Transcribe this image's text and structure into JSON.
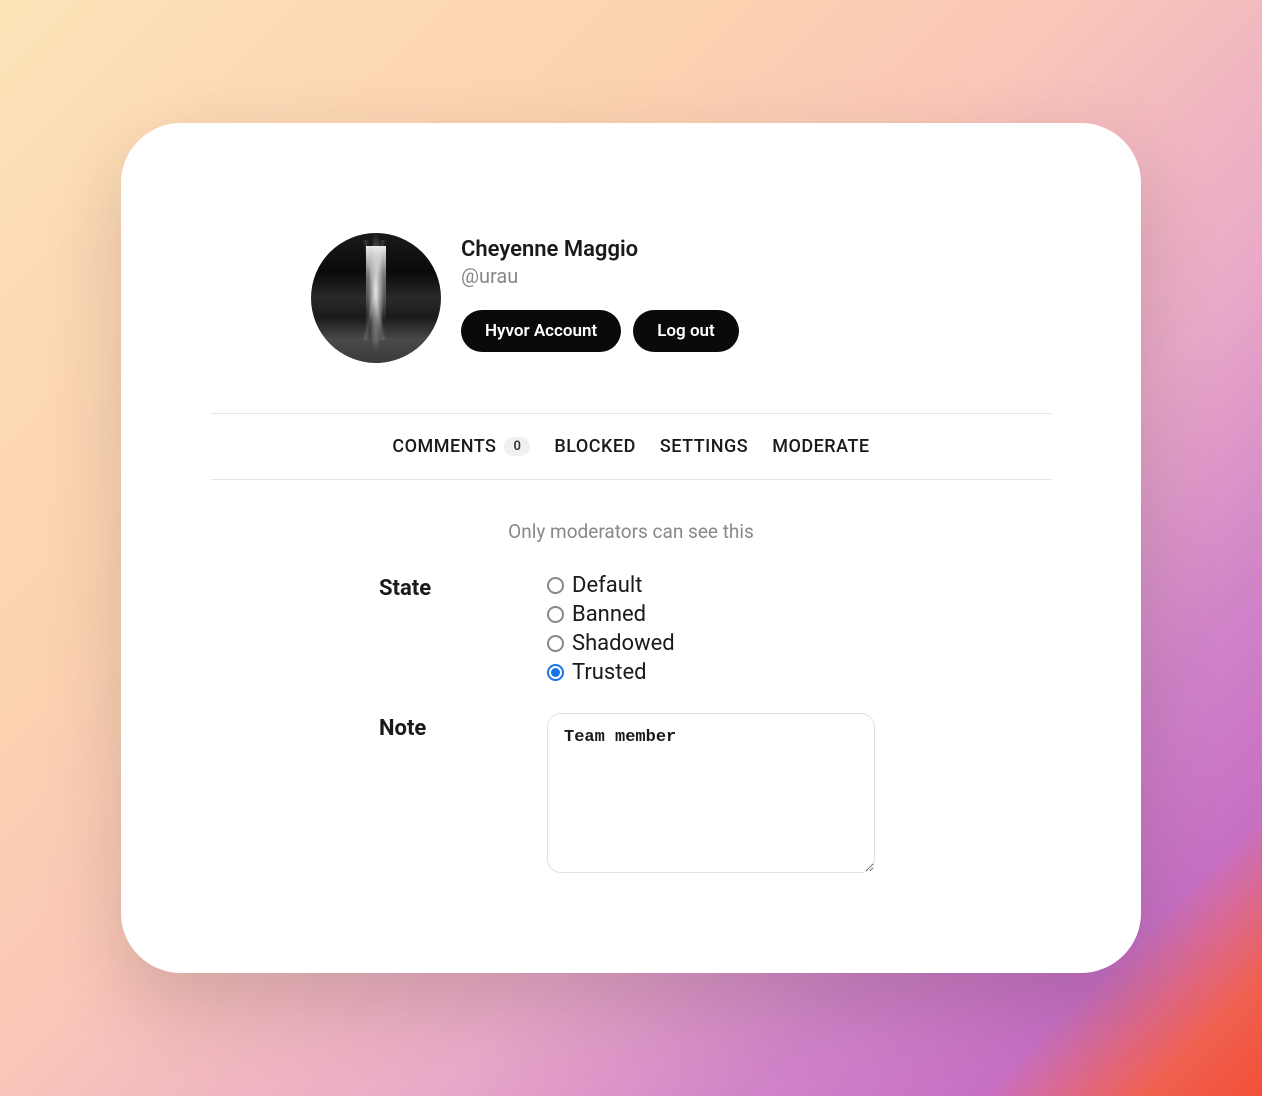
{
  "profile": {
    "name": "Cheyenne Maggio",
    "handle": "@urau",
    "actions": {
      "account": "Hyvor Account",
      "logout": "Log out"
    }
  },
  "tabs": {
    "comments": "COMMENTS",
    "comments_count": "0",
    "blocked": "BLOCKED",
    "settings": "SETTINGS",
    "moderate": "MODERATE"
  },
  "moderate": {
    "visibility_note": "Only moderators can see this",
    "state_label": "State",
    "note_label": "Note",
    "state_options": {
      "default": "Default",
      "banned": "Banned",
      "shadowed": "Shadowed",
      "trusted": "Trusted"
    },
    "selected_state": "trusted",
    "note_value": "Team member"
  }
}
